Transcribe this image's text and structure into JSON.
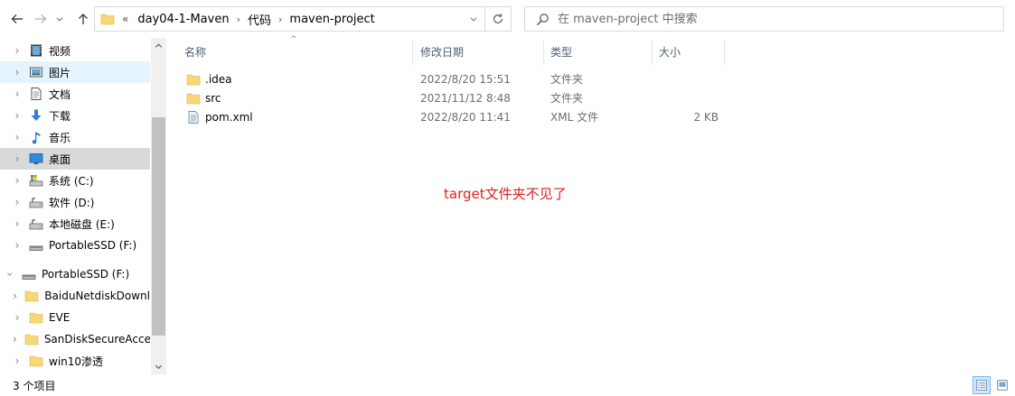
{
  "toolbar": {
    "back": "back-arrow",
    "forward": "forward-arrow",
    "recent": "chevron-down",
    "up": "up-arrow"
  },
  "address": {
    "overflow": "«",
    "crumbs": [
      "day04-1-Maven",
      "代码",
      "maven-project"
    ]
  },
  "search": {
    "placeholder": "在 maven-project 中搜索"
  },
  "nav": {
    "items": [
      {
        "label": "视频",
        "icon": "video-icon"
      },
      {
        "label": "图片",
        "icon": "pictures-icon"
      },
      {
        "label": "文档",
        "icon": "documents-icon"
      },
      {
        "label": "下载",
        "icon": "downloads-icon"
      },
      {
        "label": "音乐",
        "icon": "music-icon"
      },
      {
        "label": "桌面",
        "icon": "desktop-icon"
      },
      {
        "label": "系统 (C:)",
        "icon": "system-drive-icon"
      },
      {
        "label": "软件 (D:)",
        "icon": "drive-icon"
      },
      {
        "label": "本地磁盘 (E:)",
        "icon": "drive-icon"
      },
      {
        "label": "PortableSSD (F:)",
        "icon": "usb-drive-icon"
      },
      {
        "label": "PortableSSD (F:)",
        "icon": "usb-drive-icon"
      },
      {
        "label": "BaiduNetdiskDownl",
        "icon": "folder-icon"
      },
      {
        "label": "EVE",
        "icon": "folder-icon"
      },
      {
        "label": "SanDiskSecureAcce",
        "icon": "folder-icon"
      },
      {
        "label": "win10渗透",
        "icon": "folder-icon"
      }
    ]
  },
  "columns": {
    "name": "名称",
    "date": "修改日期",
    "type": "类型",
    "size": "大小"
  },
  "files": [
    {
      "name": ".idea",
      "date": "2022/8/20 15:51",
      "type": "文件夹",
      "size": "",
      "icon": "folder-icon"
    },
    {
      "name": "src",
      "date": "2021/11/12 8:48",
      "type": "文件夹",
      "size": "",
      "icon": "folder-icon"
    },
    {
      "name": "pom.xml",
      "date": "2022/8/20 11:41",
      "type": "XML 文件",
      "size": "2 KB",
      "icon": "xml-file-icon"
    }
  ],
  "annotation": "target文件夹不见了",
  "status": {
    "count": "3 个项目"
  },
  "colors": {
    "annotation": "#e02020",
    "selected": "#d9d9d9",
    "folder": "#f8d775"
  }
}
